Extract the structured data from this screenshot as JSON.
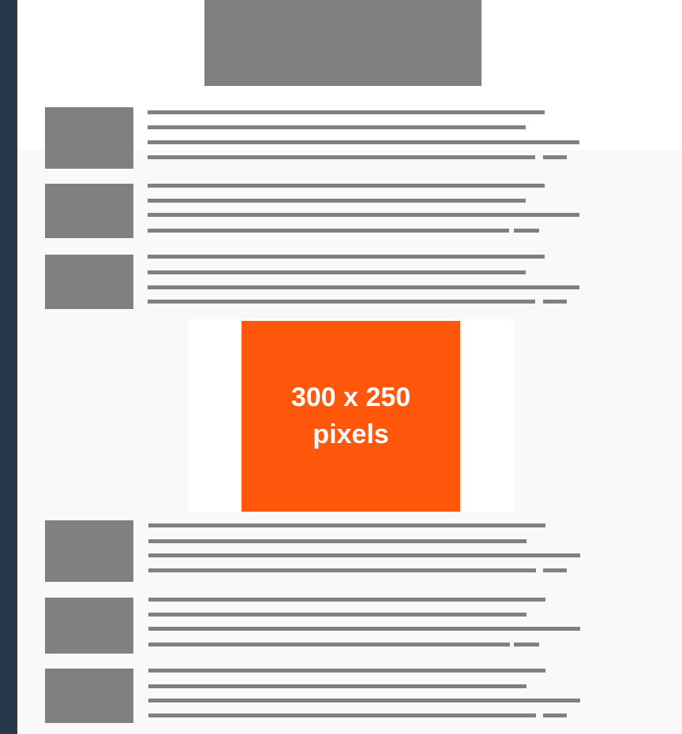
{
  "colors": {
    "frame_background": "#263849",
    "page_background": "#f9f9f9",
    "placeholder_gray": "#808080",
    "ad_orange": "#ff580c",
    "ad_text": "#ffffff"
  },
  "ad": {
    "line1": "300 x 250",
    "line2": "pixels"
  },
  "articles_above_ad": 3,
  "articles_below_ad": 3
}
